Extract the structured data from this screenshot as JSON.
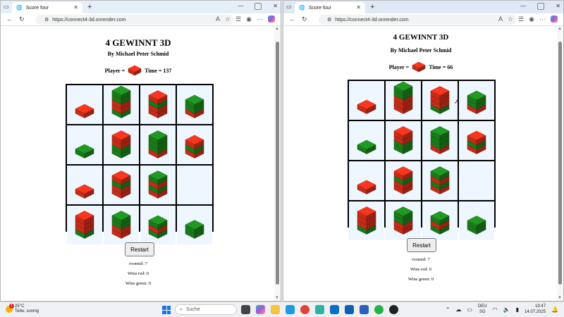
{
  "browser": {
    "tab_title": "Score four",
    "url": "https://connect4-3d.onrender.com"
  },
  "game_left": {
    "title": "4 GEWINNT 3D",
    "subtitle": "By Michael Peter Schmid",
    "player_label": "Player =",
    "player_color": "red",
    "time_text": "Time = 137",
    "restart_label": "Restart",
    "roomid_text": "roomid: 7",
    "wins_red_text": "Wins red: 0",
    "wins_green_text": "Wins green: 0",
    "board": [
      [
        [
          "R"
        ],
        [
          "G",
          "R",
          "R",
          "G",
          "G"
        ],
        [
          "R",
          "R",
          "G",
          "R"
        ],
        [
          "R",
          "G",
          "G"
        ]
      ],
      [
        [
          "G"
        ],
        [
          "G",
          "G",
          "R",
          "R"
        ],
        [
          "R",
          "G",
          "G",
          "G"
        ],
        [
          "R",
          "G",
          "R"
        ]
      ],
      [
        [
          "R"
        ],
        [
          "R",
          "R",
          "G",
          "R"
        ],
        [
          "R",
          "G",
          "R",
          "G"
        ],
        []
      ],
      [
        [
          "G",
          "R",
          "R",
          "R"
        ],
        [
          "R",
          "R",
          "G",
          "G"
        ],
        [
          "G",
          "R",
          "G"
        ],
        [
          "G",
          "G"
        ]
      ]
    ]
  },
  "game_right": {
    "title": "4 GEWINNT 3D",
    "subtitle": "By Michael Peter Schmid",
    "player_label": "Player =",
    "player_color": "red",
    "time_text": "Time = 66",
    "restart_label": "Restart",
    "roomid_text": "roomid: 7",
    "wins_red_text": "Wins red: 0",
    "wins_green_text": "Wins green: 0",
    "board": [
      [
        [
          "R"
        ],
        [
          "R",
          "R",
          "R",
          "G",
          "G"
        ],
        [
          "G",
          "R",
          "R",
          "R"
        ],
        [
          "R",
          "G",
          "G"
        ]
      ],
      [
        [
          "G"
        ],
        [
          "G",
          "G",
          "R",
          "R"
        ],
        [
          "R",
          "G",
          "G",
          "G"
        ],
        [
          "R",
          "G",
          "R"
        ]
      ],
      [
        [
          "R"
        ],
        [
          "R",
          "R",
          "G",
          "R"
        ],
        [
          "R",
          "G",
          "R",
          "G"
        ],
        []
      ],
      [
        [
          "G",
          "R",
          "R",
          "R"
        ],
        [
          "R",
          "R",
          "G",
          "G"
        ],
        [
          "G",
          "R",
          "G"
        ],
        [
          "G",
          "G"
        ]
      ]
    ]
  },
  "colors": {
    "red": "#e8321c",
    "green": "#1e8f1e",
    "board_bg": "#eef6ff"
  },
  "taskbar": {
    "weather_temp": "25°C",
    "weather_desc": "Teilw. sonnig",
    "weather_badge": "1",
    "search_placeholder": "Suche",
    "lang_primary": "DEU",
    "lang_secondary": "SG",
    "time": "19:47",
    "date": "14.07.2025"
  }
}
